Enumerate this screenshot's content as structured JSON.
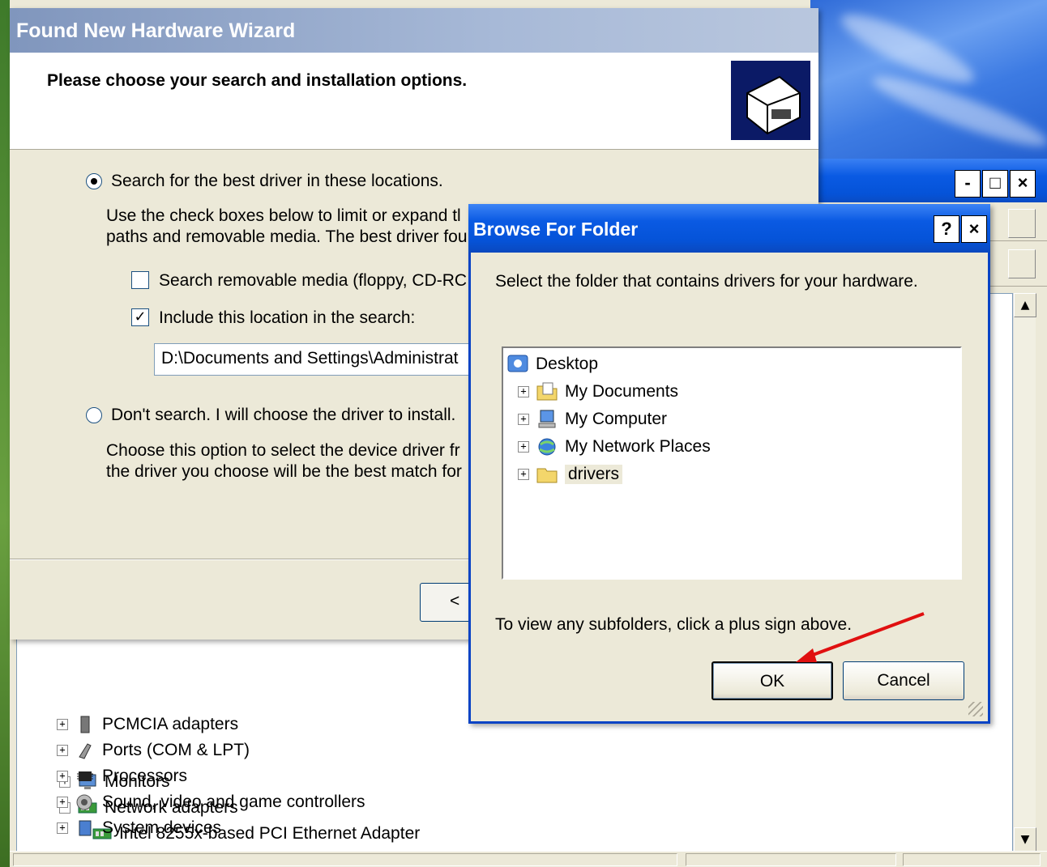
{
  "wizard": {
    "title": "Found New Hardware Wizard",
    "heading": "Please choose your search and installation options.",
    "option_search": "Search for the best driver in these locations.",
    "option_search_desc_1": "Use the check boxes below to limit or expand tl",
    "option_search_desc_2": "paths and removable media. The best driver fou",
    "check_removable": "Search removable media (floppy, CD-RC",
    "check_include": "Include this location in the search:",
    "path_value": "D:\\Documents and Settings\\Administrat",
    "option_dont_search": "Don't search. I will choose the driver to install.",
    "option_dont_desc_1": "Choose this option to select the device driver fr",
    "option_dont_desc_2": "the driver you choose will be the best match for",
    "back_label": "<"
  },
  "device_manager": {
    "minimize": "-",
    "maximize": "□",
    "close": "×",
    "scroll_up": "▲",
    "scroll_down": "▼",
    "tree": [
      {
        "label": "Monitors",
        "expander": "+"
      },
      {
        "label": "Network adapters",
        "expander": "−"
      },
      {
        "label": "Intel 8255x-based PCI Ethernet Adapter",
        "expander": ""
      },
      {
        "label": "PCMCIA adapters",
        "expander": "+"
      },
      {
        "label": "Ports (COM & LPT)",
        "expander": "+"
      },
      {
        "label": "Processors",
        "expander": "+"
      },
      {
        "label": "Sound, video and game controllers",
        "expander": "+"
      },
      {
        "label": "System devices",
        "expander": "+"
      }
    ]
  },
  "browse": {
    "title": "Browse For Folder",
    "help": "?",
    "close": "×",
    "description": "Select the folder that contains drivers for your hardware.",
    "root": "Desktop",
    "nodes": [
      {
        "label": "My Documents",
        "expander": "+",
        "icon": "my-documents-icon"
      },
      {
        "label": "My Computer",
        "expander": "+",
        "icon": "my-computer-icon"
      },
      {
        "label": "My Network Places",
        "expander": "+",
        "icon": "network-places-icon"
      },
      {
        "label": "drivers",
        "expander": "+",
        "icon": "folder-icon"
      }
    ],
    "hint": "To view any subfolders, click a plus sign above.",
    "ok_label": "OK",
    "cancel_label": "Cancel"
  },
  "colors": {
    "xp_blue": "#0a5ae3",
    "annotation_red": "#e01010"
  }
}
